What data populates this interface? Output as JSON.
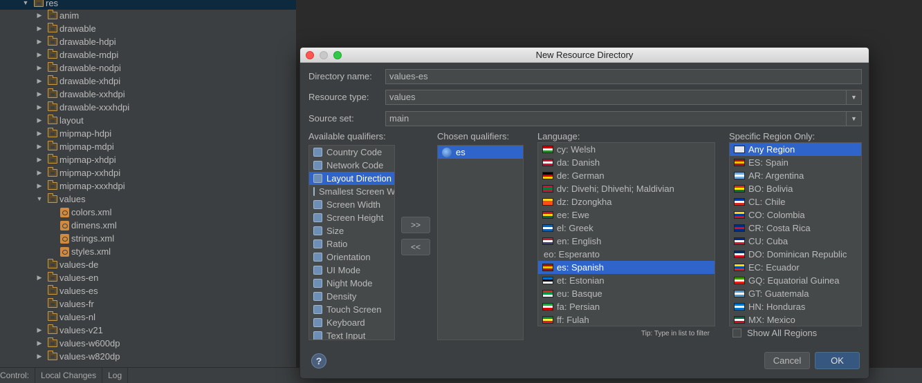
{
  "tree": {
    "root": {
      "label": "res"
    },
    "items": [
      {
        "label": "anim",
        "type": "folder",
        "arrow": "right"
      },
      {
        "label": "drawable",
        "type": "folder",
        "arrow": "right"
      },
      {
        "label": "drawable-hdpi",
        "type": "folder",
        "arrow": "right"
      },
      {
        "label": "drawable-mdpi",
        "type": "folder",
        "arrow": "right"
      },
      {
        "label": "drawable-nodpi",
        "type": "folder",
        "arrow": "right"
      },
      {
        "label": "drawable-xhdpi",
        "type": "folder",
        "arrow": "right"
      },
      {
        "label": "drawable-xxhdpi",
        "type": "folder",
        "arrow": "right"
      },
      {
        "label": "drawable-xxxhdpi",
        "type": "folder",
        "arrow": "right"
      },
      {
        "label": "layout",
        "type": "folder",
        "arrow": "right"
      },
      {
        "label": "mipmap-hdpi",
        "type": "folder",
        "arrow": "right"
      },
      {
        "label": "mipmap-mdpi",
        "type": "folder",
        "arrow": "right"
      },
      {
        "label": "mipmap-xhdpi",
        "type": "folder",
        "arrow": "right"
      },
      {
        "label": "mipmap-xxhdpi",
        "type": "folder",
        "arrow": "right"
      },
      {
        "label": "mipmap-xxxhdpi",
        "type": "folder",
        "arrow": "right"
      },
      {
        "label": "values",
        "type": "folder",
        "arrow": "down"
      },
      {
        "label": "colors.xml",
        "type": "xml",
        "arrow": "none",
        "child": true
      },
      {
        "label": "dimens.xml",
        "type": "xml",
        "arrow": "none",
        "child": true
      },
      {
        "label": "strings.xml",
        "type": "xml",
        "arrow": "none",
        "child": true
      },
      {
        "label": "styles.xml",
        "type": "xml",
        "arrow": "none",
        "child": true
      },
      {
        "label": "values-de",
        "type": "folder",
        "arrow": "none"
      },
      {
        "label": "values-en",
        "type": "folder",
        "arrow": "right"
      },
      {
        "label": "values-es",
        "type": "folder",
        "arrow": "none"
      },
      {
        "label": "values-fr",
        "type": "folder",
        "arrow": "none"
      },
      {
        "label": "values-nl",
        "type": "folder",
        "arrow": "none"
      },
      {
        "label": "values-v21",
        "type": "folder",
        "arrow": "right"
      },
      {
        "label": "values-w600dp",
        "type": "folder",
        "arrow": "right"
      },
      {
        "label": "values-w820dp",
        "type": "folder",
        "arrow": "right"
      }
    ]
  },
  "statusbar": {
    "items": [
      "Control:",
      "Local Changes",
      "Log"
    ]
  },
  "dialog": {
    "title": "New Resource Directory",
    "directory_name_label": "Directory name:",
    "directory_name_value": "values-es",
    "resource_type_label": "Resource type:",
    "resource_type_value": "values",
    "source_set_label": "Source set:",
    "source_set_value": "main",
    "available_label": "Available qualifiers:",
    "chosen_label": "Chosen qualifiers:",
    "language_label": "Language:",
    "region_label": "Specific Region Only:",
    "available_qualifiers": [
      {
        "label": "Country Code",
        "icon": "country-code-icon"
      },
      {
        "label": "Network Code",
        "icon": "network-code-icon"
      },
      {
        "label": "Layout Direction",
        "icon": "layout-direction-icon",
        "selected": true
      },
      {
        "label": "Smallest Screen Width",
        "icon": "smallest-screen-icon"
      },
      {
        "label": "Screen Width",
        "icon": "screen-width-icon"
      },
      {
        "label": "Screen Height",
        "icon": "screen-height-icon"
      },
      {
        "label": "Size",
        "icon": "size-icon"
      },
      {
        "label": "Ratio",
        "icon": "ratio-icon"
      },
      {
        "label": "Orientation",
        "icon": "orientation-icon"
      },
      {
        "label": "UI Mode",
        "icon": "ui-mode-icon"
      },
      {
        "label": "Night Mode",
        "icon": "night-mode-icon"
      },
      {
        "label": "Density",
        "icon": "density-icon"
      },
      {
        "label": "Touch Screen",
        "icon": "touch-screen-icon"
      },
      {
        "label": "Keyboard",
        "icon": "keyboard-icon"
      },
      {
        "label": "Text Input",
        "icon": "text-input-icon"
      }
    ],
    "chosen_qualifiers": [
      {
        "label": "es",
        "icon": "globe-icon",
        "selected": true
      }
    ],
    "add_button": ">>",
    "remove_button": "<<",
    "languages": [
      {
        "label": "cy: Welsh",
        "flag": [
          "#cc0000",
          "#ffffff",
          "#2a8a2a"
        ]
      },
      {
        "label": "da: Danish",
        "flag": [
          "#c8102e",
          "#ffffff",
          "#c8102e"
        ]
      },
      {
        "label": "de: German",
        "flag": [
          "#000000",
          "#dd0000",
          "#ffce00"
        ]
      },
      {
        "label": "dv: Divehi; Dhivehi; Maldivian",
        "flag": [
          "#d21034",
          "#007e3a",
          "#d21034"
        ]
      },
      {
        "label": "dz: Dzongkha",
        "flag": [
          "#ffd520",
          "#ff4e12",
          "#ff4e12"
        ]
      },
      {
        "label": "ee: Ewe",
        "flag": [
          "#ce1126",
          "#fcd116",
          "#006b3f"
        ]
      },
      {
        "label": "el: Greek",
        "flag": [
          "#0d5eaf",
          "#ffffff",
          "#0d5eaf"
        ]
      },
      {
        "label": "en: English",
        "flag": [
          "#b22234",
          "#ffffff",
          "#3c3b6e"
        ]
      },
      {
        "label": "eo: Esperanto",
        "flag": []
      },
      {
        "label": "es: Spanish",
        "flag": [
          "#aa151b",
          "#f1bf00",
          "#aa151b"
        ],
        "selected": true
      },
      {
        "label": "et: Estonian",
        "flag": [
          "#0072ce",
          "#000000",
          "#ffffff"
        ]
      },
      {
        "label": "eu: Basque",
        "flag": [
          "#d52b1e",
          "#009b48",
          "#ffffff"
        ]
      },
      {
        "label": "fa: Persian",
        "flag": [
          "#239f40",
          "#ffffff",
          "#da0000"
        ]
      },
      {
        "label": "ff: Fulah",
        "flag": [
          "#00853f",
          "#fdef42",
          "#e31b23"
        ]
      }
    ],
    "regions": [
      {
        "label": "Any Region",
        "flag": [
          "#dfe6ee",
          "#dfe6ee",
          "#dfe6ee"
        ],
        "selected": true
      },
      {
        "label": "ES: Spain",
        "flag": [
          "#aa151b",
          "#f1bf00",
          "#aa151b"
        ]
      },
      {
        "label": "AR: Argentina",
        "flag": [
          "#74acdf",
          "#ffffff",
          "#74acdf"
        ]
      },
      {
        "label": "BO: Bolivia",
        "flag": [
          "#d52b1e",
          "#f9e300",
          "#007934"
        ]
      },
      {
        "label": "CL: Chile",
        "flag": [
          "#0039a6",
          "#ffffff",
          "#d52b1e"
        ]
      },
      {
        "label": "CO: Colombia",
        "flag": [
          "#fcd116",
          "#003893",
          "#ce1126"
        ]
      },
      {
        "label": "CR: Costa Rica",
        "flag": [
          "#002b7f",
          "#ce1126",
          "#002b7f"
        ]
      },
      {
        "label": "CU: Cuba",
        "flag": [
          "#002a8f",
          "#ffffff",
          "#cf142b"
        ]
      },
      {
        "label": "DO: Dominican Republic",
        "flag": [
          "#002d62",
          "#ffffff",
          "#ce1126"
        ]
      },
      {
        "label": "EC: Ecuador",
        "flag": [
          "#ffdd00",
          "#034ea2",
          "#ed1c24"
        ]
      },
      {
        "label": "GQ: Equatorial Guinea",
        "flag": [
          "#3e9a00",
          "#ffffff",
          "#e32118"
        ]
      },
      {
        "label": "GT: Guatemala",
        "flag": [
          "#4997d0",
          "#ffffff",
          "#4997d0"
        ]
      },
      {
        "label": "HN: Honduras",
        "flag": [
          "#0073cf",
          "#ffffff",
          "#0073cf"
        ]
      },
      {
        "label": "MX: Mexico",
        "flag": [
          "#006847",
          "#ffffff",
          "#ce1126"
        ]
      }
    ],
    "tip": "Tip: Type in list to filter",
    "show_all_regions": "Show All Regions",
    "help_label": "?",
    "cancel_label": "Cancel",
    "ok_label": "OK"
  }
}
